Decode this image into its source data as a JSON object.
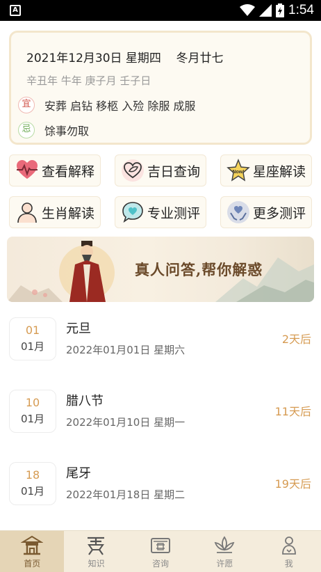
{
  "status_bar": {
    "time": "1:54",
    "app_icon_letter": "A"
  },
  "almanac": {
    "date_line": "2021年12月30日 星期四    冬月廿七",
    "ganzhi_line": "辛丑年 牛年 庚子月 壬子日",
    "yi_badge": "宜",
    "yi_text": "安葬 启钻 移柩 入殓 除服 成服",
    "ji_badge": "忌",
    "ji_text": "馀事勿取"
  },
  "features": [
    {
      "label": "查看解释",
      "icon": "heartbeat-icon"
    },
    {
      "label": "吉日查询",
      "icon": "heart-leaf-icon"
    },
    {
      "label": "星座解读",
      "icon": "star-now-icon"
    },
    {
      "label": "生肖解读",
      "icon": "person-icon"
    },
    {
      "label": "专业测评",
      "icon": "chat-heart-icon"
    },
    {
      "label": "更多测评",
      "icon": "hands-heart-icon"
    }
  ],
  "banner": {
    "text": "真人问答,帮你解惑"
  },
  "holidays": [
    {
      "day": "01",
      "month": "01月",
      "name": "元旦",
      "date": "2022年01月01日 星期六",
      "remaining": "2天后"
    },
    {
      "day": "10",
      "month": "01月",
      "name": "腊八节",
      "date": "2022年01月10日 星期一",
      "remaining": "11天后"
    },
    {
      "day": "18",
      "month": "01月",
      "name": "尾牙",
      "date": "2022年01月18日 星期二",
      "remaining": "19天后"
    }
  ],
  "tabs": [
    {
      "label": "首页",
      "icon": "temple-icon",
      "active": true
    },
    {
      "label": "知识",
      "icon": "book-stand-icon",
      "active": false
    },
    {
      "label": "咨询",
      "icon": "consult-box-icon",
      "active": false
    },
    {
      "label": "许愿",
      "icon": "lotus-icon",
      "active": false
    },
    {
      "label": "我",
      "icon": "user-icon",
      "active": false
    }
  ],
  "colors": {
    "accent": "#d69b52",
    "card_bg": "#fdfaf2",
    "tab_bar_bg": "#f4ecdc",
    "yi_red": "#d0544a",
    "ji_green": "#6aa84f"
  }
}
